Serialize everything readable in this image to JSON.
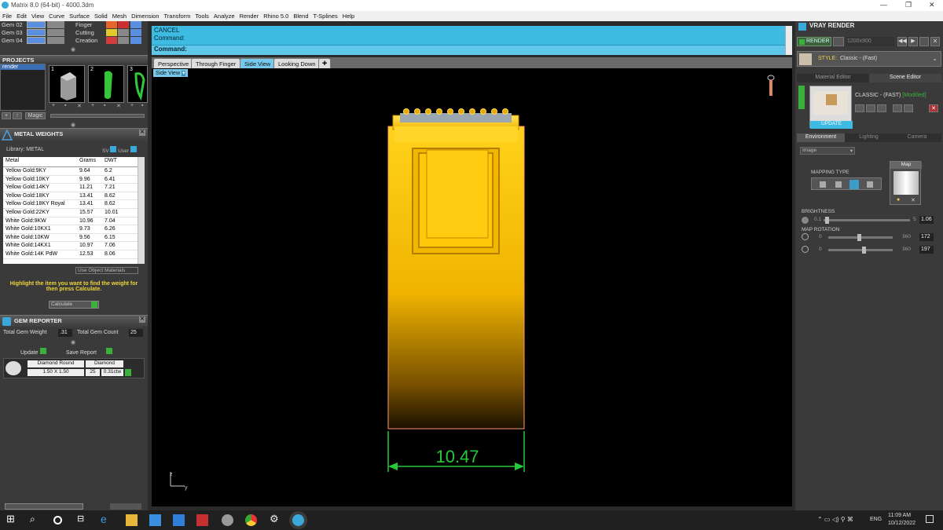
{
  "window": {
    "title": "Matrix 8.0 (64-bit) - 4000.3dm"
  },
  "menu": [
    "File",
    "Edit",
    "View",
    "Curve",
    "Surface",
    "Solid",
    "Mesh",
    "Dimension",
    "Transform",
    "Tools",
    "Analyze",
    "Render",
    "Rhino 5.0",
    "Blend",
    "T-Splines",
    "Help"
  ],
  "layers": [
    {
      "name": "Gem 02",
      "name2": "Finger"
    },
    {
      "name": "Gem 03",
      "name2": "Cutting"
    },
    {
      "name": "Gem 04",
      "name2": "Creation"
    }
  ],
  "projects": {
    "title": "PROJECTS",
    "item": "render",
    "thumbs": [
      "1",
      "2",
      "3"
    ],
    "magic": "Magic"
  },
  "metal_weights": {
    "title": "METAL WEIGHTS",
    "library_label": "Library: METAL",
    "sv_label": "SV",
    "user_label": "User",
    "columns": [
      "Metal",
      "Grams",
      "DWT"
    ],
    "rows": [
      [
        "Yellow Gold:9KY",
        "9.64",
        "6.2"
      ],
      [
        "Yellow Gold:10KY",
        "9.96",
        "6.41"
      ],
      [
        "Yellow Gold:14KY",
        "11.21",
        "7.21"
      ],
      [
        "Yellow Gold:18KY",
        "13.41",
        "8.62"
      ],
      [
        "Yellow Gold:18KY Royal",
        "13.41",
        "8.62"
      ],
      [
        "Yellow Gold:22KY",
        "15.57",
        "10.01"
      ],
      [
        "White Gold:9KW",
        "10.96",
        "7.04"
      ],
      [
        "White Gold:10KX1",
        "9.73",
        "6.26"
      ],
      [
        "White Gold:10KW",
        "9.56",
        "6.15"
      ],
      [
        "White Gold:14KX1",
        "10.97",
        "7.06"
      ],
      [
        "White Gold:14K PdW",
        "12.53",
        "8.06"
      ]
    ],
    "use_object_materials": "Use Object Materials",
    "hint": "Highlight the item you want to find the weight for then press Calculate.",
    "calculate": "Calculate"
  },
  "gem_reporter": {
    "title": "GEM REPORTER",
    "total_weight_label": "Total Gem Weight",
    "total_weight": ".31",
    "total_count_label": "Total Gem Count",
    "total_count": "25",
    "update": "Update",
    "save_report": "Save Report",
    "gem_shape": "Diamond Round",
    "gem_type": "Diamond",
    "gem_size": "1.50 X 1.50",
    "gem_count": "25",
    "gem_weight": "0.31ctw"
  },
  "command": {
    "line1": "CANCEL",
    "line2": "Command:",
    "line3": "Command:"
  },
  "view_tabs": [
    "Perspective",
    "Through Finger",
    "Side View",
    "Looking Down"
  ],
  "view_label": "Side View",
  "dimension": {
    "value": "10.47"
  },
  "axes": {
    "z": "z",
    "y": "y"
  },
  "vray": {
    "title": "VRAY RENDER",
    "render_btn": "RENDER",
    "resolution": "1200x900",
    "style_label": "STYLE:",
    "style_value": "Classic - (Fast)",
    "tabs": [
      "Material Editor",
      "Scene Editor"
    ],
    "scene_name": "CLASSIC - (FAST)",
    "modified": "[Modified]",
    "update": "UPDATE",
    "env_tabs": [
      "Environment",
      "Lighting",
      "Camera"
    ],
    "env_select": "Image",
    "mapping_type": "MAPPING TYPE",
    "map_label": "Map",
    "brightness": {
      "label": "BRIGHTNESS",
      "min": "0.1",
      "max": "5",
      "value": "1.06",
      "fraction": 0.04
    },
    "map_rotation": {
      "label": "MAP ROTATION",
      "min": "0",
      "max": "360",
      "value1": "172",
      "value2": "197",
      "fraction1": 0.48,
      "fraction2": 0.55
    }
  },
  "taskbar": {
    "lang": "ENG",
    "time": "11:09 AM",
    "date": "10/12/2022"
  },
  "colors": {
    "cyan": "#3dbbe2",
    "gold": "#ffc300",
    "dim_green": "#25c93a",
    "accent_yellow": "#e8d24a"
  }
}
